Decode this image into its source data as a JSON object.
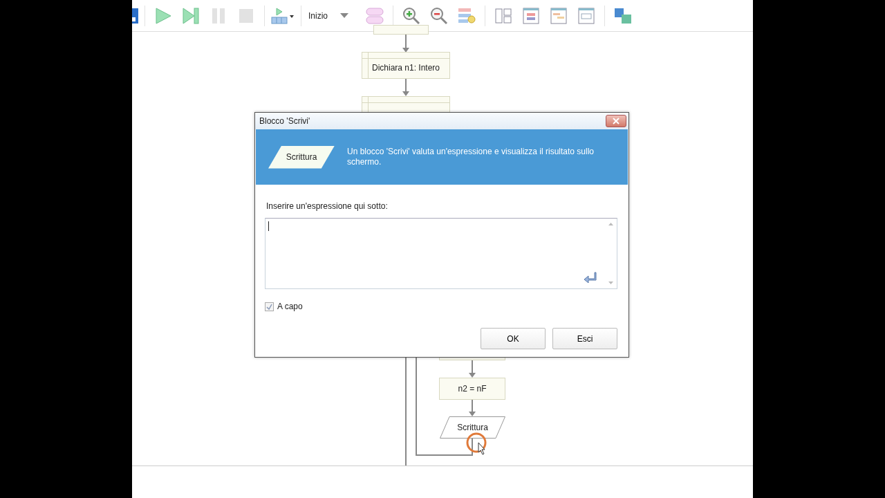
{
  "toolbar": {
    "start_selector": {
      "value": "Inizio"
    }
  },
  "flowchart": {
    "blocks": [
      {
        "kind": "process"
      },
      {
        "kind": "declare",
        "text": "Dichiara n1: Intero"
      },
      {
        "kind": "declare"
      },
      {
        "kind": "process"
      },
      {
        "kind": "process",
        "text": "n2 = nF"
      },
      {
        "kind": "output",
        "text": "Scrittura"
      }
    ]
  },
  "dialog": {
    "title": "Blocco 'Scrivi'",
    "header": {
      "shape_label": "Scrittura",
      "description": "Un blocco 'Scrivi' valuta un'espressione e visualizza il risultato sullo schermo."
    },
    "prompt": "Inserire un'espressione qui sotto:",
    "newline_option": {
      "label": "A capo",
      "checked": true
    },
    "buttons": [
      "OK",
      "Esci"
    ]
  }
}
